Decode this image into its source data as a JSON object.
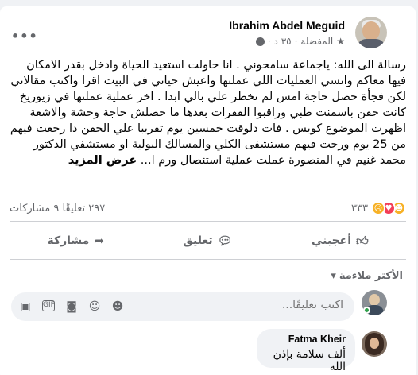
{
  "post": {
    "author": "Ibrahim Abdel Meguid",
    "audience": "المفضلة",
    "time": "٣٥ د",
    "menu": "•••",
    "text": "رسالة الى الله: ياجماعة سامحوني . انا حاولت استعيد الحياة وادخل بقدر الامكان فيها معاكم وانسي العمليات اللي عملتها واعيش حياتي في البيت اقرا واكتب مقالاتي لكن فجأة حصل حاجة امس لم تخطر علي بالي ابدا . اخر عملية عملتها في زيوريخ كانت حقن باسمنت طبي وراقبوا الفقرات بعدها ما حصلش حاجة وحشة والاشعة اظهرت الموضوع كويس . فات دلوقت خمسين يوم تقريبا علي الحقن دا رجعت فيهم من 25 يوم ورحت فيهم مستشفى الكلي والمسالك البولية او مستشفي الدكتور محمد غنيم في المنصورة عملت عملية استئصال ورم ا...",
    "see_more": "عرض المزيد"
  },
  "stats": {
    "reactions_count": "٣٣٣",
    "comments_shares": "٢٩٧ تعليقًا ٩ مشاركات"
  },
  "actions": {
    "like": "أعجبني",
    "comment": "تعليق",
    "share": "مشاركة"
  },
  "comments": {
    "sort_label": "الأكثر ملاءمة",
    "composer_placeholder": "اكتب تعليقًا...",
    "items": [
      {
        "author": "Fatma Kheir",
        "text": "ألف سلامة بإذن الله"
      }
    ]
  },
  "colors": {
    "secondary_text": "#65676b",
    "love": "#f33e58",
    "care": "#f7b125"
  }
}
